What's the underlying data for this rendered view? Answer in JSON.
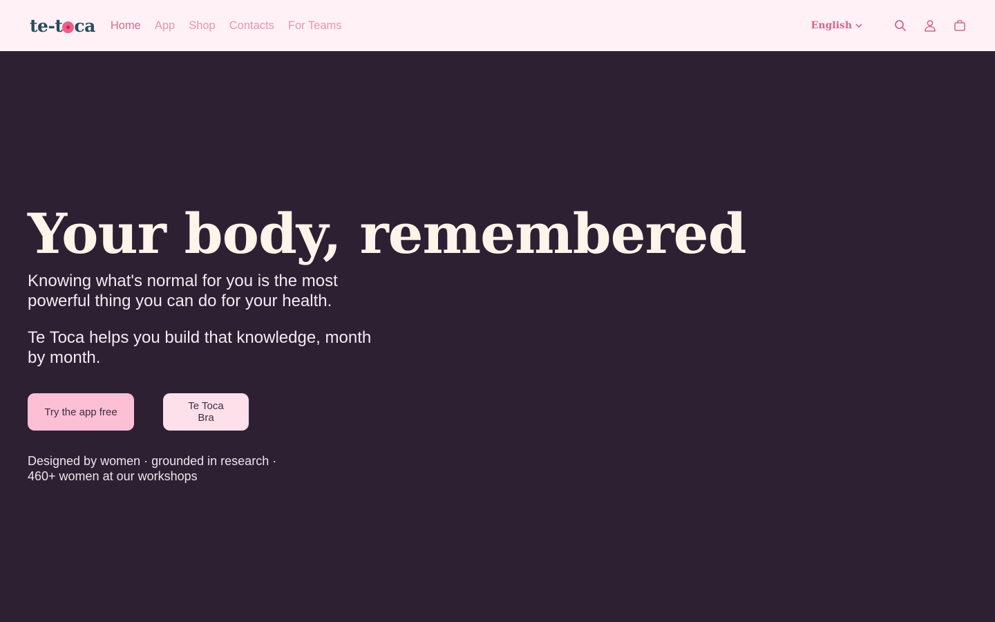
{
  "header": {
    "logo_before": "te-t",
    "logo_after": "ca",
    "nav": [
      {
        "label": "Home",
        "active": true
      },
      {
        "label": "App"
      },
      {
        "label": "Shop"
      },
      {
        "label": "Contacts"
      },
      {
        "label": "For Teams"
      }
    ],
    "language": "English",
    "icons": [
      "search-icon",
      "account-icon",
      "cart-icon"
    ]
  },
  "hero": {
    "title": "Your body, remembered",
    "lead": "Knowing what's normal for you is the most powerful thing you can do for your health.",
    "lead2": "Te Toca helps you build that knowledge, month by month.",
    "primary_cta": "Try the app free",
    "secondary_cta": "Te Toca Bra",
    "note_line1": "Designed by women · grounded in research ·",
    "note_line2": "460+ women at our workshops"
  },
  "colors": {
    "header_bg": "#fff1f5",
    "hero_bg": "#2d2033",
    "accent_pink": "#e796b3",
    "logo_teal": "#274b5f",
    "title_cream": "#fdf5ea"
  }
}
